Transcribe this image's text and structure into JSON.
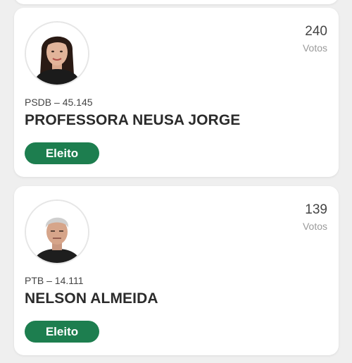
{
  "accent_color": "#1d7e4f",
  "candidates": [
    {
      "photo": "candidate-photo-woman",
      "votes_count": "240",
      "votes_label": "Votos",
      "party": "PSDB – 45.145",
      "name": "PROFESSORA NEUSA JORGE",
      "status": "Eleito"
    },
    {
      "photo": "candidate-photo-man",
      "votes_count": "139",
      "votes_label": "Votos",
      "party": "PTB – 14.111",
      "name": "NELSON ALMEIDA",
      "status": "Eleito"
    }
  ]
}
